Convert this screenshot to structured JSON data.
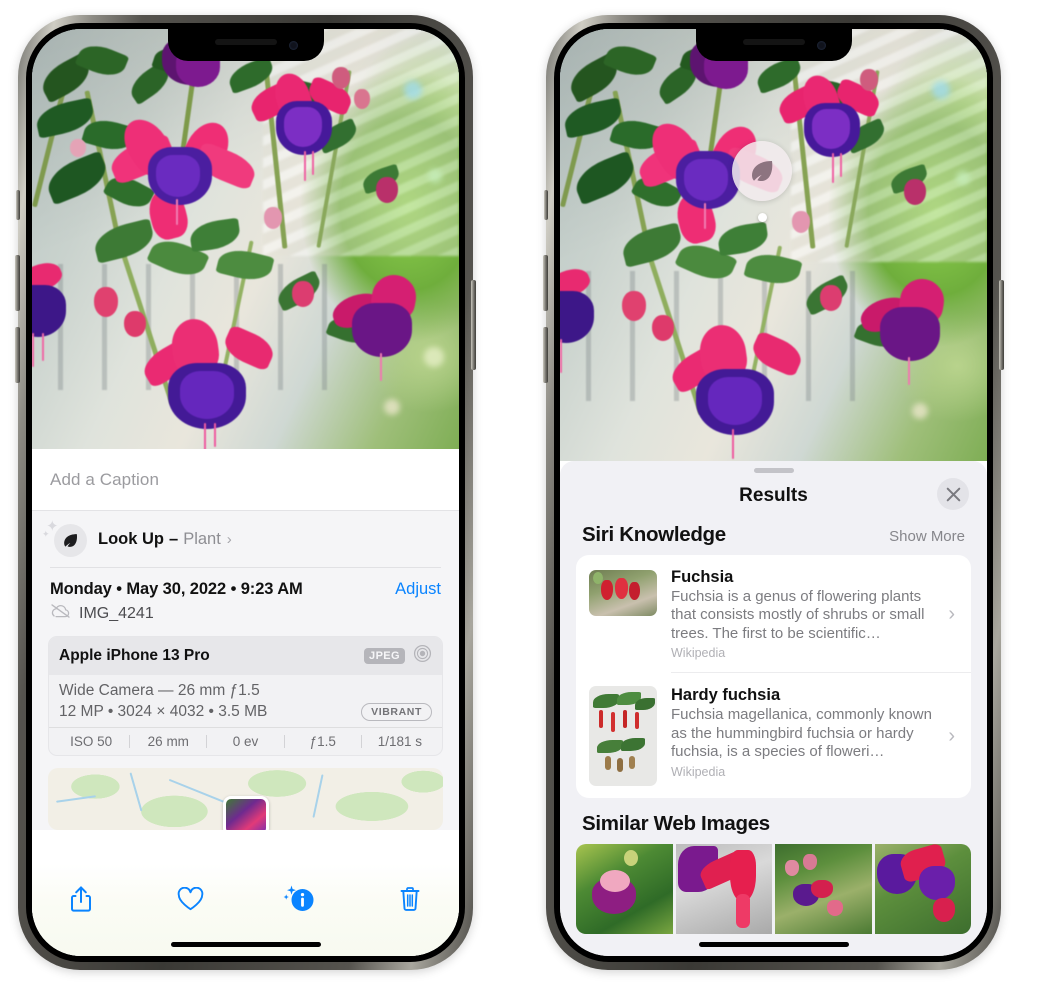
{
  "device": {
    "model_frame": "iPhone 13 Pro",
    "notch_icons": [
      "front-camera",
      "earpiece-speaker"
    ]
  },
  "left_phone": {
    "photo_alt": "Fuchsia flowers hanging basket",
    "caption": {
      "placeholder": "Add a Caption",
      "value": ""
    },
    "lookup": {
      "icon": "leaf-icon",
      "label": "Look Up",
      "dash": "–",
      "subject": "Plant",
      "chevron": "›"
    },
    "date_line": "Monday • May 30, 2022 • 9:23 AM",
    "adjust_label": "Adjust",
    "file_icon": "icloud-slash-icon",
    "file_name": "IMG_4241",
    "exif": {
      "device": "Apple iPhone 13 Pro",
      "format_badge": "JPEG",
      "lens_icon": "aperture-icon",
      "lens_line": "Wide Camera — 26 mm ƒ1.5",
      "size_line": "12 MP • 3024 × 4032 • 3.5 MB",
      "style_badge": "VIBRANT",
      "stats": [
        "ISO 50",
        "26 mm",
        "0 ev",
        "ƒ1.5",
        "1/181 s"
      ]
    },
    "map": {
      "pin": "photo-thumbnail-pin"
    },
    "toolbar": [
      {
        "name": "share-button",
        "icon": "share-icon"
      },
      {
        "name": "favorite-button",
        "icon": "heart-icon"
      },
      {
        "name": "info-button",
        "icon": "info-sparkle-icon"
      },
      {
        "name": "delete-button",
        "icon": "trash-icon"
      }
    ]
  },
  "right_phone": {
    "visual_lookup_badge": {
      "icon": "leaf-icon",
      "anchor_dot": true
    },
    "sheet": {
      "grabber": true,
      "title": "Results",
      "close_icon": "close-icon"
    },
    "siri_knowledge": {
      "title": "Siri Knowledge",
      "show_more": "Show More",
      "items": [
        {
          "title": "Fuchsia",
          "description": "Fuchsia is a genus of flowering plants that consists mostly of shrubs or small trees. The first to be scientific…",
          "source": "Wikipedia",
          "thumbnail": "fuchsia-red-flowers-thumb",
          "chevron": "›"
        },
        {
          "title": "Hardy fuchsia",
          "description": "Fuchsia magellanica, commonly known as the hummingbird fuchsia or hardy fuchsia, is a species of floweri…",
          "source": "Wikipedia",
          "thumbnail": "hardy-fuchsia-specimen-thumb",
          "chevron": "›"
        }
      ]
    },
    "similar_web_images": {
      "title": "Similar Web Images",
      "images": [
        {
          "name": "web-image-1",
          "alt": "pink and purple fuchsia with leaves"
        },
        {
          "name": "web-image-2",
          "alt": "red fuchsia buds closeup"
        },
        {
          "name": "web-image-3",
          "alt": "fuchsia shrub with many blooms"
        },
        {
          "name": "web-image-4",
          "alt": "purple and magenta fuchsia cluster"
        }
      ]
    }
  },
  "colors": {
    "accent_blue": "#0a84ff",
    "sheet_bg": "#f1f1f5",
    "card_bg": "#ffffff",
    "secondary_text": "#8e8e93",
    "exif_header_bg": "#e7e7ea"
  }
}
